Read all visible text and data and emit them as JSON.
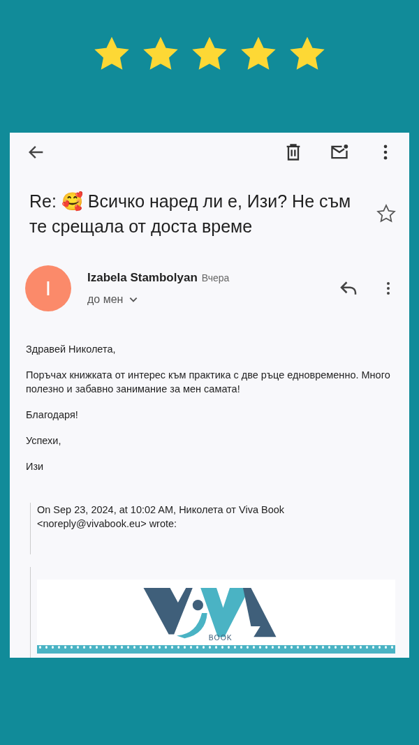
{
  "rating": {
    "stars": 5
  },
  "email": {
    "subject_prefix": "Re:",
    "subject_emoji": "🥰",
    "subject": "Всичко наред ли е, Изи? Не съм те срещала от доста време",
    "starred": false,
    "sender": {
      "initial": "I",
      "name": "Izabela Stambolyan",
      "time": "Вчера",
      "recipient": "до мен"
    },
    "body": [
      "Здравей Николета,",
      "Поръчах книжката от интерес към практика с две ръце едновременно. Много полезно и забавно занимание за мен самата!",
      "Благодаря!",
      "Успехи,",
      "Изи"
    ],
    "quote_header": "On Sep 23, 2024, at 10:02 AM, Николета от Viva Book <noreply@vivabook.eu> wrote:",
    "logo_text": "BOOK"
  }
}
